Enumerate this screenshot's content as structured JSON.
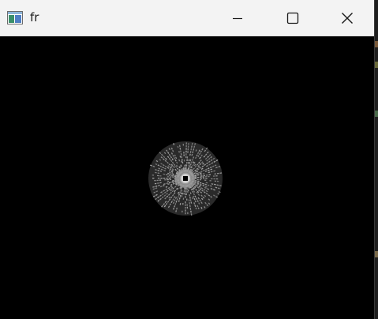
{
  "window": {
    "title": "fr",
    "app_icon": "app-window-icon",
    "controls": {
      "minimize_icon": "minimize-icon",
      "maximize_icon": "maximize-icon",
      "close_icon": "close-icon"
    }
  },
  "canvas": {
    "background_color": "#000000",
    "figure_color": "#a8a8a8",
    "center_color": "#000000"
  }
}
